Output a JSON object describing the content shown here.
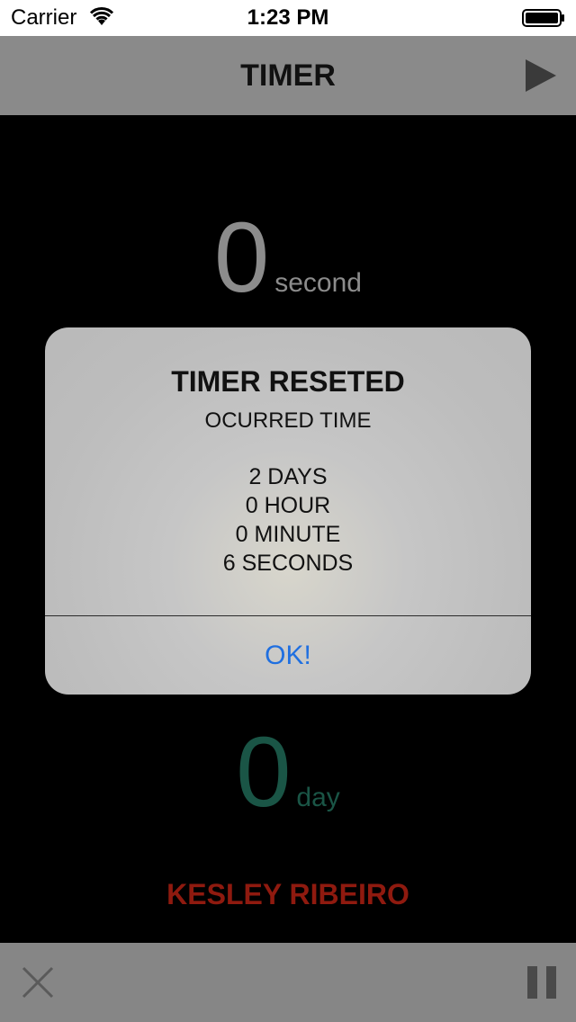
{
  "status_bar": {
    "carrier": "Carrier",
    "time": "1:23 PM",
    "wifi_icon": "wifi-icon",
    "battery_icon": "battery-full-icon"
  },
  "nav": {
    "title": "TIMER",
    "play_icon": "play-icon"
  },
  "counters": {
    "seconds": {
      "value": "0",
      "unit": "second",
      "color": "#8c8c8c"
    },
    "days": {
      "value": "0",
      "unit": "day",
      "color": "#1a5546"
    }
  },
  "author": {
    "name": "KESLEY RIBEIRO",
    "color": "#8f1a0f"
  },
  "toolbar": {
    "close_icon": "close-icon",
    "pause_icon": "pause-icon"
  },
  "alert": {
    "title": "TIMER RESETED",
    "subtitle": "OCURRED TIME",
    "lines": [
      "2 DAYS",
      "0 HOUR",
      "0 MINUTE",
      "6 SECONDS"
    ],
    "ok_label": "OK!",
    "ok_color": "#1f6fe0"
  }
}
